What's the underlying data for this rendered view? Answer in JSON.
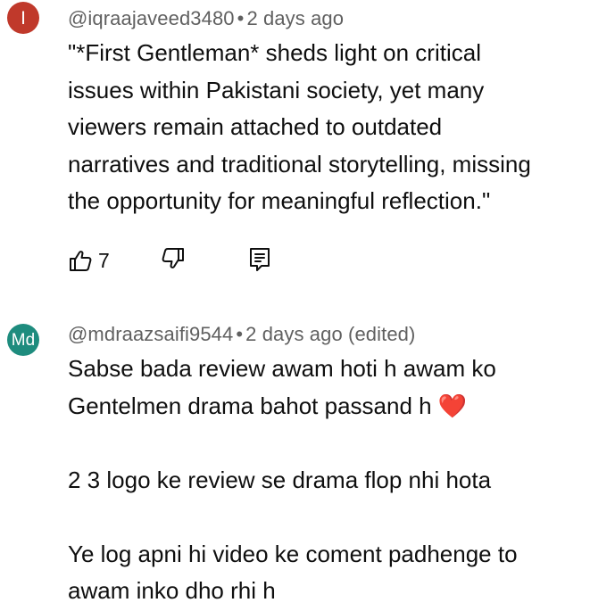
{
  "comments": [
    {
      "avatar_letter": "I",
      "avatar_color": "#c0392b",
      "handle": "@iqraajaveed3480",
      "separator": "•",
      "time": "2 days ago",
      "lines": [
        "\"*First Gentleman* sheds light on critical",
        "issues within Pakistani society, yet many",
        "viewers remain attached to outdated",
        "narratives and traditional storytelling, missing",
        "the opportunity for meaningful reflection.\""
      ],
      "like_count": "7",
      "icons": [
        "thumbs-up-icon",
        "thumbs-down-icon",
        "reply-icon"
      ]
    },
    {
      "avatar_letter": "Md",
      "avatar_color": "#1e8c7e",
      "handle": "@mdraazsaifi9544",
      "separator": "•",
      "time": "2 days ago (edited)",
      "lines": [
        "Sabse bada review awam hoti h  awam ko",
        "Gentelmen  drama  bahot passand h ❤️",
        "",
        "2  3 logo ke review se drama  flop nhi hota",
        "",
        "Ye log apni hi video ke coment  padhenge to",
        "awam inko dho rhi h"
      ]
    }
  ]
}
